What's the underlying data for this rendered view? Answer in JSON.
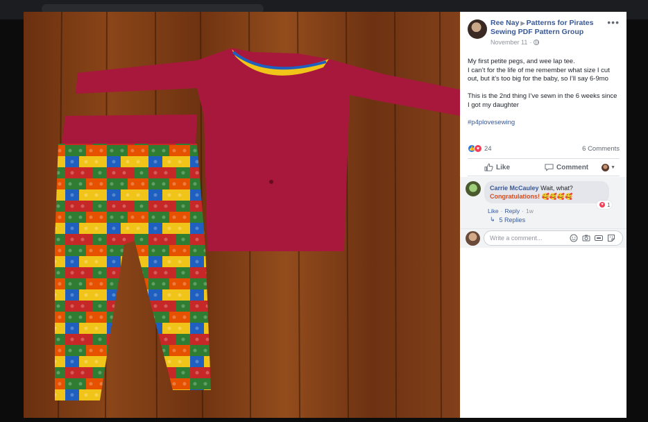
{
  "post": {
    "author": "Ree Nay",
    "group": "Patterns for Pirates Sewing PDF Pattern Group",
    "date": "November 11",
    "more_label": "•••",
    "body": [
      "My first petite pegs, and wee lap tee.",
      "I can’t for the life of me remember what size I cut out, but it’s too big for the baby, so I’ll say 6-9mo",
      "This is the 2nd thing I’ve sewn in the 6 weeks since I got my daughter"
    ],
    "hashtag": "#p4plovesewing",
    "reaction_count": "24",
    "comments_count": "6 Comments"
  },
  "actions": {
    "like_label": "Like",
    "comment_label": "Comment"
  },
  "comment": {
    "name": "Carrie McCauley",
    "text": "Wait, what?",
    "congrats": "Congratulations!",
    "emojis": "🥰🥰🥰🥰",
    "reaction_count": "1",
    "like_label": "Like",
    "reply_label": "Reply",
    "time": "1w",
    "replies_label": "5 Replies"
  },
  "composer": {
    "placeholder": "Write a comment..."
  },
  "icons": {
    "more": "more-icon",
    "globe": "globe-icon",
    "like": "thumbs-up-icon",
    "love": "heart-icon",
    "comment": "speech-bubble-icon",
    "emoji": "smiley-icon",
    "camera": "camera-icon",
    "gif": "gif-icon",
    "sticker": "sticker-icon",
    "reply": "reply-arrow-icon"
  },
  "colors": {
    "link": "#385898",
    "shirt": "#a8183c",
    "wood": "#7a3a14",
    "like": "#1877f2",
    "love": "#f33e58"
  }
}
